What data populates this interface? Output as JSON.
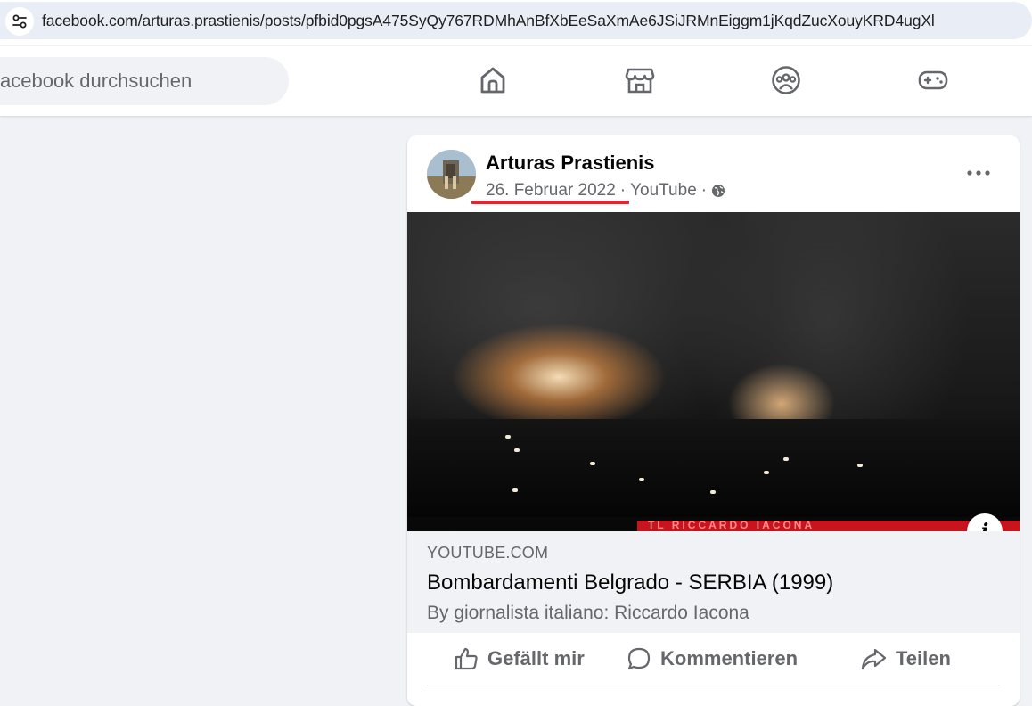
{
  "browser": {
    "url": "facebook.com/arturas.prastienis/posts/pfbid0pgsA475SyQy767RDMhAnBfXbEeSaXmAe6JSiJRMnEiggm1jKqdZucXouyKRD4ugXl",
    "site_settings_icon": "tune-icon"
  },
  "header": {
    "search_placeholder": "acebook durchsuchen",
    "nav_icons": [
      "home-icon",
      "marketplace-icon",
      "groups-icon",
      "gaming-icon"
    ]
  },
  "post": {
    "author": "Arturas Prastienis",
    "date": "26. Februar 2022",
    "separator": "·",
    "source": "YouTube",
    "privacy_icon": "globe-icon",
    "annotation_color": "#e8232f",
    "video": {
      "ticker_text": "TL   RICCARDO IACONA",
      "info_label": "i"
    },
    "link": {
      "domain": "YOUTUBE.COM",
      "title": "Bombardamenti Belgrado - SERBIA (1999)",
      "description": "By giornalista italiano: Riccardo Iacona"
    },
    "actions": {
      "like": "Gefällt mir",
      "comment": "Kommentieren",
      "share": "Teilen"
    }
  },
  "colors": {
    "fb_background": "#f0f2f5",
    "secondary_text": "#65676b",
    "primary_text": "#050505"
  }
}
